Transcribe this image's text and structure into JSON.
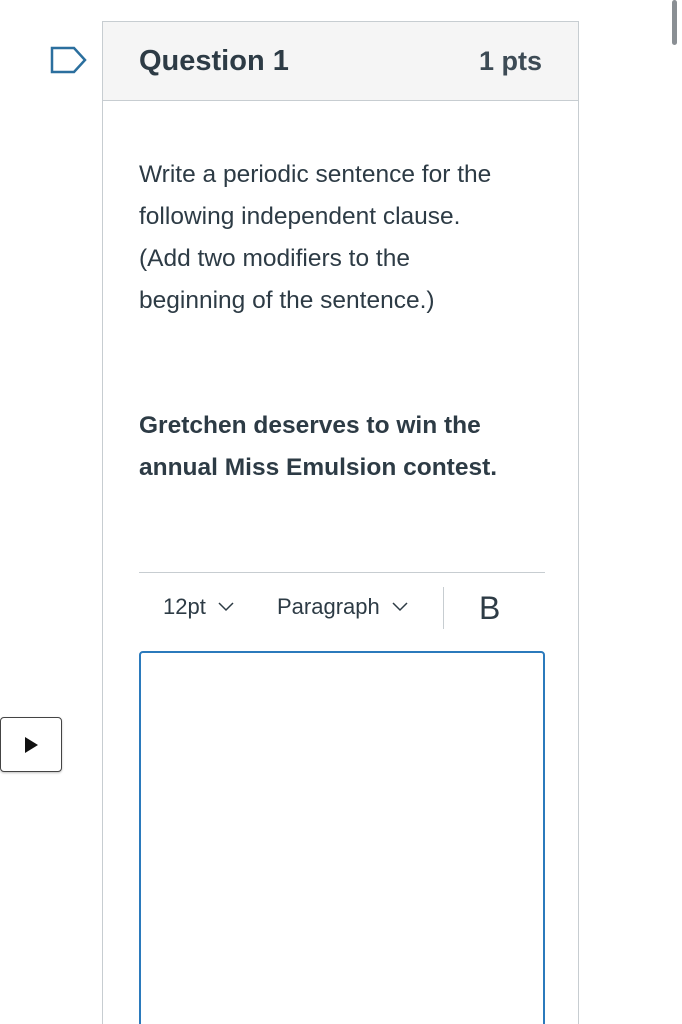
{
  "question": {
    "title": "Question 1",
    "points": "1 pts",
    "prompt_lines": [
      "Write a periodic sentence for the",
      "following independent clause.",
      "(Add two modifiers to the",
      "beginning of the sentence.)"
    ],
    "clause_lines": [
      "Gretchen deserves to win the",
      "annual Miss Emulsion contest."
    ]
  },
  "toolbar": {
    "font_size": "12pt",
    "block_format": "Paragraph",
    "bold_label": "B"
  },
  "editor": {
    "value": ""
  },
  "icons": {
    "flag": "flag-outline-icon",
    "chevron": "chevron-down-icon",
    "play": "play-icon"
  },
  "colors": {
    "flag_outline": "#2b6f9e",
    "editor_focus_border": "#2b7abc",
    "header_background": "#f5f5f5"
  }
}
